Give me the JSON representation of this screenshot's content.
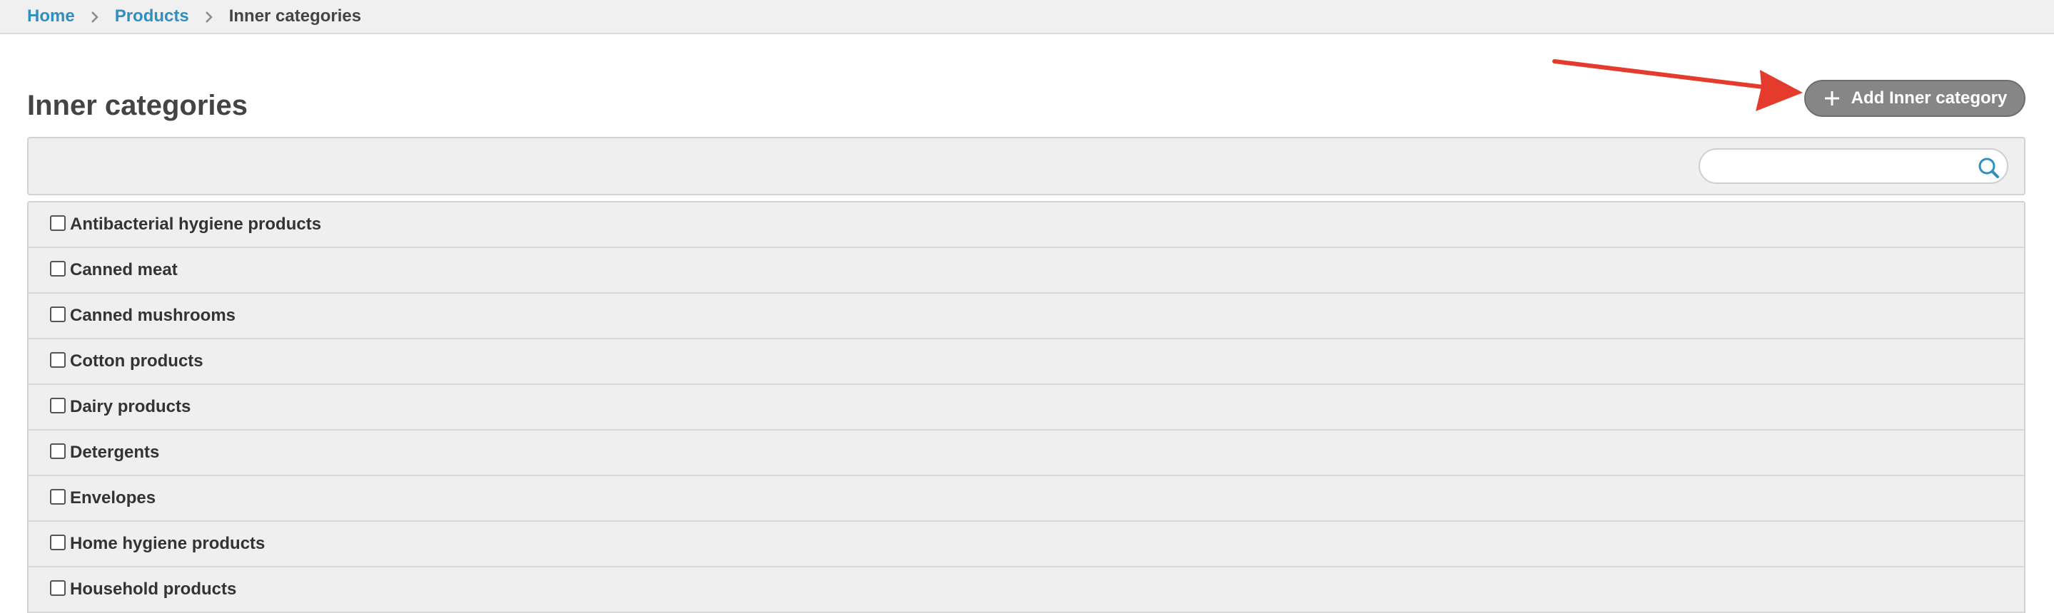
{
  "breadcrumb": {
    "home": "Home",
    "products": "Products",
    "current": "Inner categories"
  },
  "page": {
    "title": "Inner categories"
  },
  "actions": {
    "add_label": "Add Inner category"
  },
  "search": {
    "placeholder": "",
    "value": ""
  },
  "categories": [
    {
      "label": "Antibacterial hygiene products"
    },
    {
      "label": "Canned meat"
    },
    {
      "label": "Canned mushrooms"
    },
    {
      "label": "Cotton products"
    },
    {
      "label": "Dairy products"
    },
    {
      "label": "Detergents"
    },
    {
      "label": "Envelopes"
    },
    {
      "label": "Home hygiene products"
    },
    {
      "label": "Household products"
    }
  ],
  "icons": {
    "breadcrumb_separator": "chevron-right-icon",
    "add": "plus-icon",
    "search": "search-icon",
    "annotation": "red-arrow-icon"
  },
  "colors": {
    "link": "#2f8fbf",
    "button_bg": "#868686",
    "panel_bg": "#efefef",
    "annotation": "#e53b2c"
  }
}
